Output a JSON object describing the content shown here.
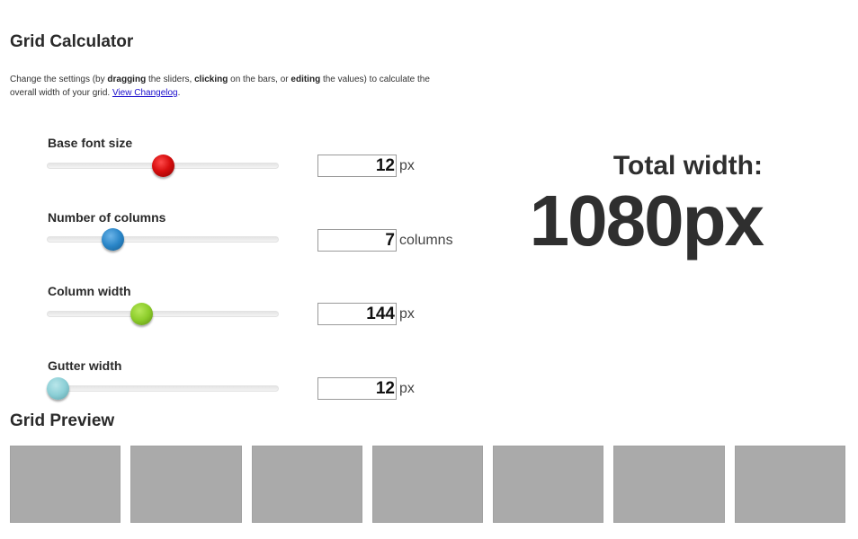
{
  "header": {
    "title": "Grid Calculator",
    "intro": {
      "part1": "Change the settings (by ",
      "bold1": "dragging",
      "part2": " the sliders, ",
      "bold2": "clicking",
      "part3": " on the bars, or ",
      "bold3": "editing",
      "part4": " the values) to calculate the overall width of your grid. ",
      "link": "View Changelog",
      "part5": "."
    }
  },
  "settings": [
    {
      "label": "Base font size",
      "value": "12",
      "unit": "px",
      "slider_fraction": 0.5,
      "knob_color": "#d80f0f"
    },
    {
      "label": "Number of columns",
      "value": "7",
      "unit": "columns",
      "slider_fraction": 0.26,
      "knob_color": "#2a86c8"
    },
    {
      "label": "Column width",
      "value": "144",
      "unit": "px",
      "slider_fraction": 0.4,
      "knob_color": "#8ccc2a"
    },
    {
      "label": "Gutter width",
      "value": "12",
      "unit": "px",
      "slider_fraction": 0.0,
      "knob_color": "#8ccfd6"
    }
  ],
  "result": {
    "label": "Total width:",
    "value": "1080px"
  },
  "preview": {
    "title": "Grid Preview",
    "columns": 7,
    "column_color": "#aaaaaa"
  }
}
